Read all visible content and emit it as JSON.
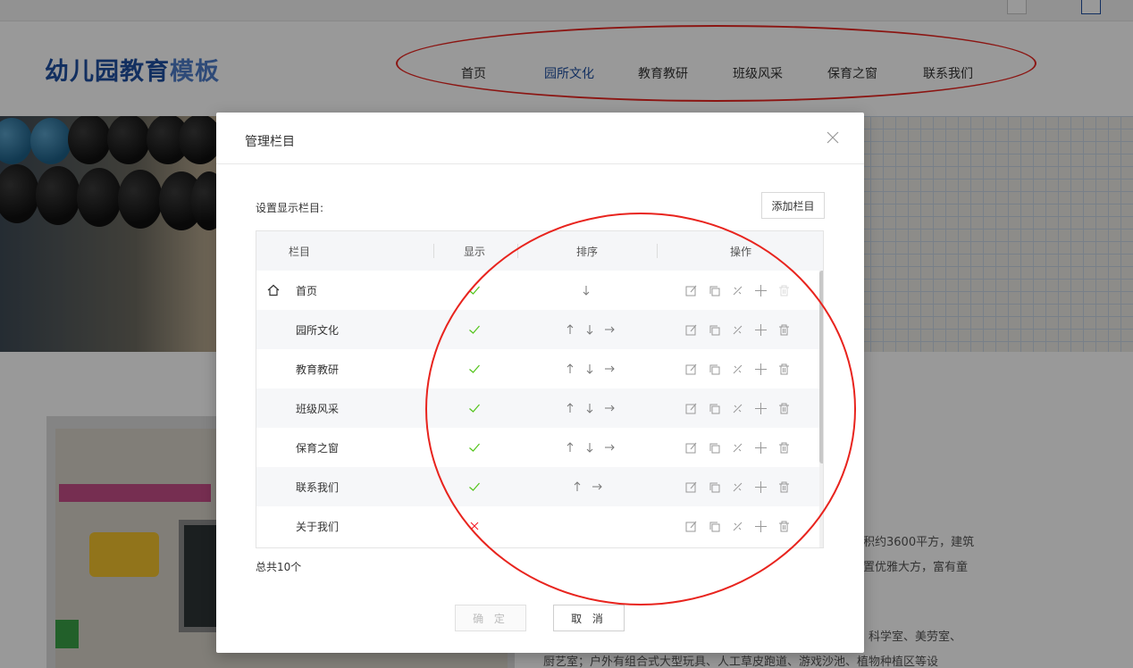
{
  "site": {
    "logo_main": "幼儿园教育",
    "logo_accent": "模板",
    "nav": [
      "首页",
      "园所文化",
      "教育教研",
      "班级风采",
      "保育之窗",
      "联系我们"
    ],
    "nav_active_index": 1,
    "nav_active_color": "#1f4fa0",
    "body_lines": [
      "积约3600平方，建筑",
      "置优雅大方，富有童",
      "科学室、美劳室、",
      "厨艺室；户外有组合式大型玩具、人工草皮跑道、游戏沙池、植物种植区等设"
    ]
  },
  "modal": {
    "title": "管理栏目",
    "section_label": "设置显示栏目:",
    "add_button": "添加栏目",
    "columns": {
      "name": "栏目",
      "show": "显示",
      "sort": "排序",
      "actions": "操作"
    },
    "rows": [
      {
        "name": "首页",
        "home": true,
        "show": true,
        "sort": [
          "down"
        ],
        "delete_enabled": false
      },
      {
        "name": "园所文化",
        "home": false,
        "show": true,
        "sort": [
          "up",
          "down",
          "right"
        ],
        "delete_enabled": true
      },
      {
        "name": "教育教研",
        "home": false,
        "show": true,
        "sort": [
          "up",
          "down",
          "right"
        ],
        "delete_enabled": true
      },
      {
        "name": "班级风采",
        "home": false,
        "show": true,
        "sort": [
          "up",
          "down",
          "right"
        ],
        "delete_enabled": true
      },
      {
        "name": "保育之窗",
        "home": false,
        "show": true,
        "sort": [
          "up",
          "down",
          "right"
        ],
        "delete_enabled": true
      },
      {
        "name": "联系我们",
        "home": false,
        "show": true,
        "sort": [
          "up",
          "right"
        ],
        "delete_enabled": true
      },
      {
        "name": "关于我们",
        "home": false,
        "show": false,
        "sort": [],
        "delete_enabled": true
      }
    ],
    "total": "总共10个",
    "confirm": "确 定",
    "cancel": "取 消"
  },
  "colors": {
    "accent": "#1f4fa0",
    "check": "#52c41a",
    "cross": "#f5222d",
    "annotation": "#e8241e"
  },
  "icons": {
    "home": "home-icon",
    "check": "check-icon",
    "cross": "cross-icon",
    "edit": "edit-icon",
    "copy": "copy-icon",
    "link": "link-off-icon",
    "add": "plus-icon",
    "delete": "trash-icon",
    "close": "close-icon"
  }
}
